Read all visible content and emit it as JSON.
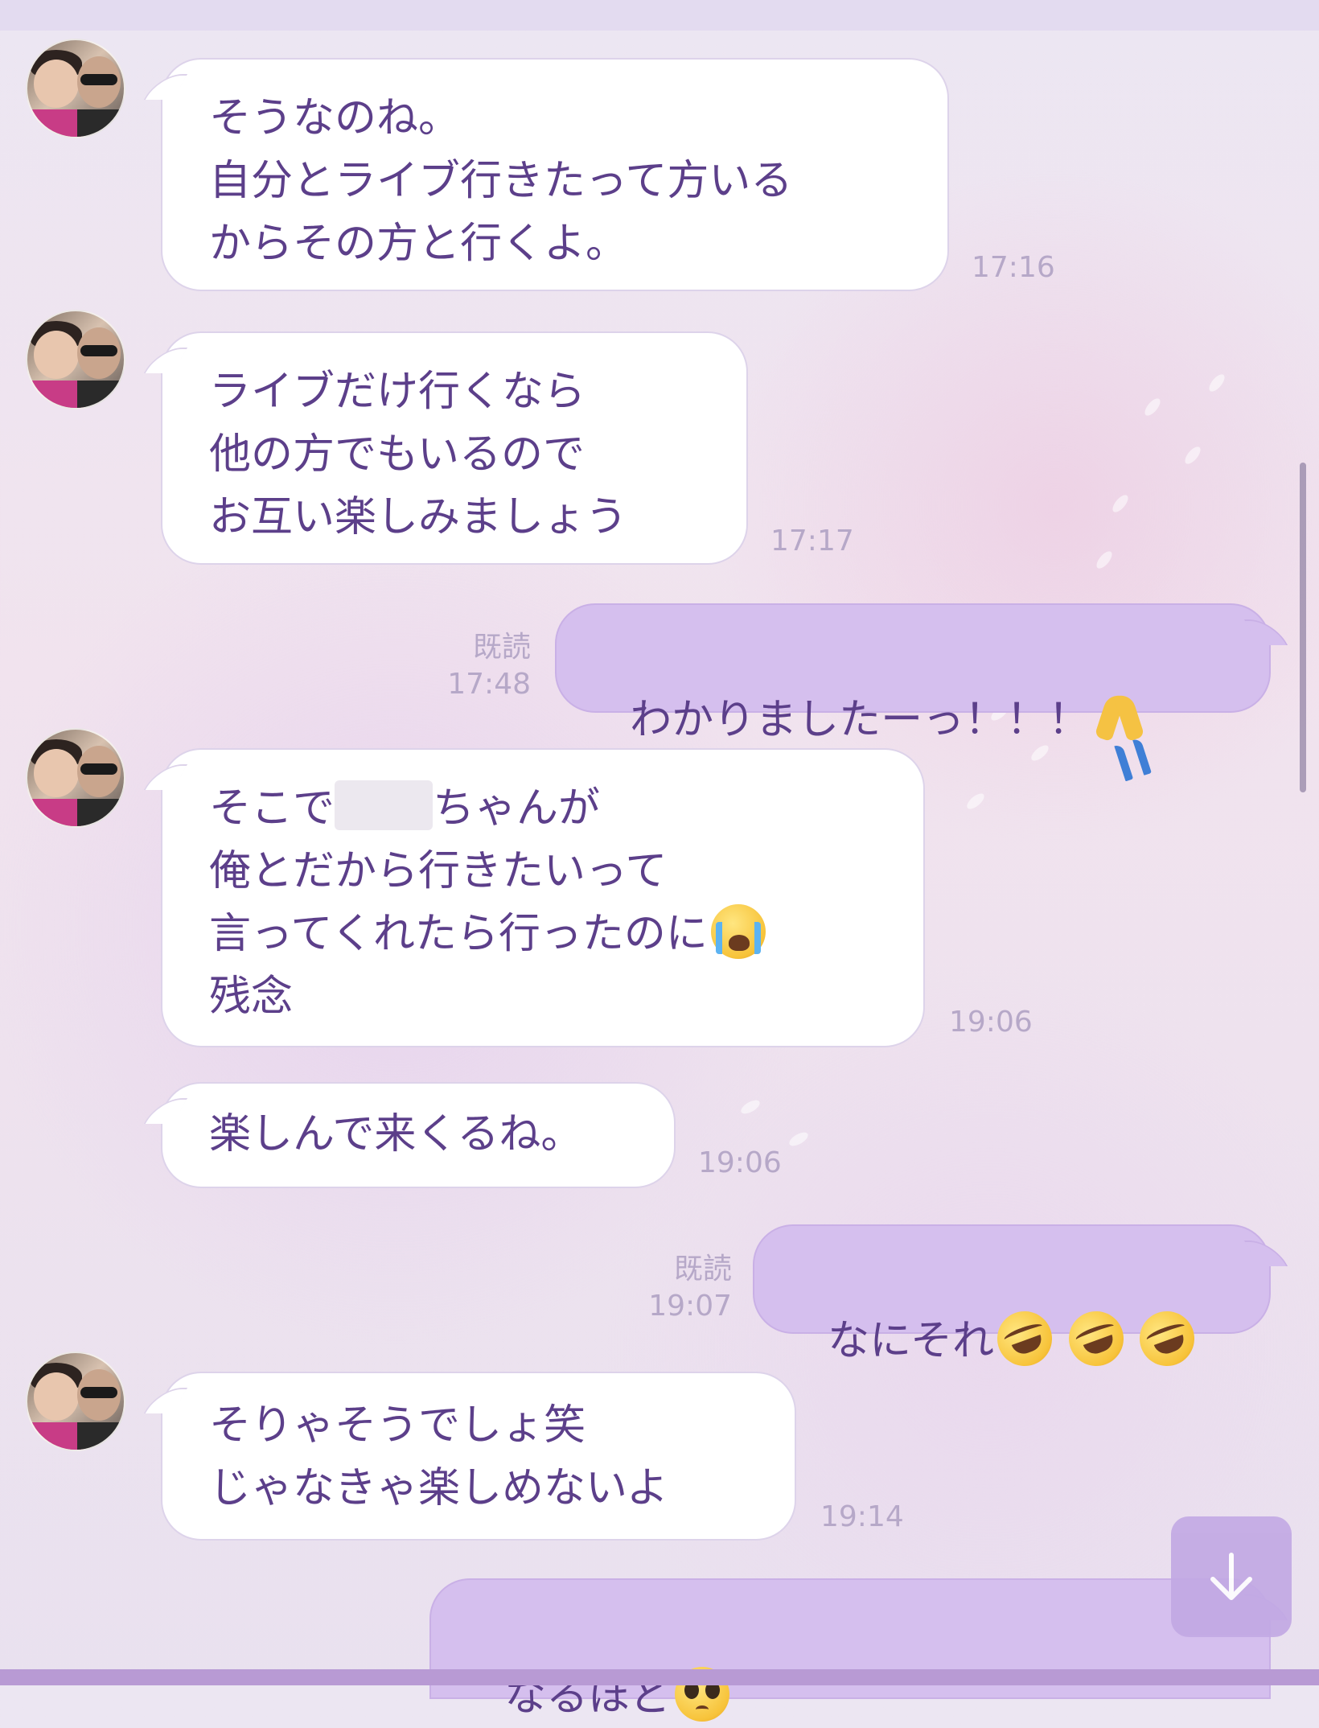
{
  "messages": [
    {
      "id": "m1",
      "side": "in",
      "text": "そうなのね。\n自分とライブ行きたって方いる\nからその方と行くよ。",
      "time": "17:16"
    },
    {
      "id": "m2",
      "side": "in",
      "text": "ライブだけ行くなら\n他の方でもいるので\nお互い楽しみましょう",
      "time": "17:17"
    },
    {
      "id": "m3",
      "side": "out",
      "text": "わかりましたーっ！！！",
      "emoji": "pray-emoji",
      "read": "既読",
      "time": "17:48"
    },
    {
      "id": "m4",
      "side": "in",
      "text_before": "そこで",
      "text_after": "ちゃんが\n俺とだから行きたいって\n言ってくれたら行ったのに",
      "emoji": "crying-emoji",
      "text_end": "\n残念",
      "time": "19:06"
    },
    {
      "id": "m5",
      "side": "in",
      "text": "楽しんで来くるね。",
      "time": "19:06"
    },
    {
      "id": "m6",
      "side": "out",
      "text": "なにそれ",
      "emoji": "rolling-laughing-emoji",
      "read": "既読",
      "time": "19:07"
    },
    {
      "id": "m7",
      "side": "in",
      "text": "そりゃそうでしょ笑\nじゃなきゃ楽しめないよ",
      "time": "19:14"
    },
    {
      "id": "m8",
      "side": "out",
      "text": "なるほど",
      "emoji": "pleading-emoji"
    }
  ],
  "icons": {
    "scroll_down": "arrow-down-icon"
  },
  "colors": {
    "incoming_bubble": "#ffffff",
    "outgoing_bubble": "#d5bfee",
    "text": "#5c3f8a",
    "timestamp": "#b6a8c8"
  }
}
